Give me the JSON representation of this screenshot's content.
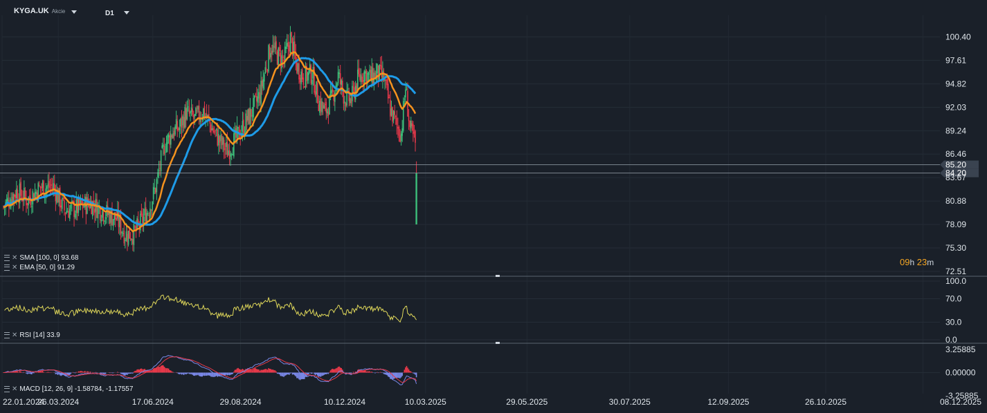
{
  "header": {
    "symbol": "KYGA.UK",
    "symbol_type": "Akcie",
    "timeframe": "D1"
  },
  "timer": {
    "hours": "09",
    "hours_unit": "h",
    "minutes": "23",
    "minutes_unit": "m"
  },
  "colors": {
    "background": "#1a2029",
    "up": "#3dbf7a",
    "down": "#e8394a",
    "sma": "#1e9be8",
    "ema": "#f5921e",
    "rsi": "#e0d85a",
    "macd_line": "#7a88e8",
    "macd_signal": "#e8394a"
  },
  "chart_data": [
    {
      "type": "candlestick",
      "name": "price",
      "y_ticks": [
        "100.40",
        "97.61",
        "94.82",
        "92.03",
        "89.24",
        "86.46",
        "83.67",
        "80.88",
        "78.09",
        "75.30",
        "72.51"
      ],
      "ylim": [
        72.51,
        101.5
      ],
      "x_ticks": [
        "22.01.2024",
        "26.03.2024",
        "17.06.2024",
        "29.08.2024",
        "10.12.2024",
        "10.03.2025",
        "29.05.2025",
        "30.07.2025",
        "12.09.2025",
        "26.10.2025",
        "08.12.2025"
      ],
      "price_lines": [
        {
          "label": "85.20",
          "value": 85.2
        },
        {
          "label": "84.20",
          "value": 84.2
        }
      ],
      "anchors": [
        [
          0,
          80.2
        ],
        [
          12,
          82.1
        ],
        [
          22,
          81.0
        ],
        [
          34,
          82.5
        ],
        [
          46,
          82.6
        ],
        [
          56,
          79.8
        ],
        [
          68,
          80.0
        ],
        [
          80,
          80.7
        ],
        [
          92,
          79.6
        ],
        [
          104,
          78.8
        ],
        [
          112,
          76.9
        ],
        [
          120,
          77.0
        ],
        [
          127,
          78.4
        ],
        [
          134,
          80.0
        ],
        [
          140,
          82.5
        ],
        [
          148,
          87.5
        ],
        [
          156,
          89.2
        ],
        [
          162,
          89.6
        ],
        [
          168,
          91.4
        ],
        [
          176,
          90.6
        ],
        [
          184,
          91.6
        ],
        [
          192,
          89.5
        ],
        [
          200,
          87.8
        ],
        [
          206,
          86.8
        ],
        [
          212,
          87.9
        ],
        [
          220,
          89.6
        ],
        [
          228,
          91.4
        ],
        [
          236,
          93.5
        ],
        [
          240,
          96.0
        ],
        [
          246,
          99.3
        ],
        [
          252,
          98.2
        ],
        [
          258,
          97.6
        ],
        [
          264,
          100.2
        ],
        [
          270,
          96.9
        ],
        [
          276,
          95.6
        ],
        [
          284,
          96.1
        ],
        [
          290,
          92.8
        ],
        [
          296,
          91.5
        ],
        [
          302,
          93.0
        ],
        [
          308,
          95.8
        ],
        [
          314,
          93.1
        ],
        [
          320,
          92.9
        ],
        [
          326,
          95.3
        ],
        [
          332,
          96.2
        ],
        [
          338,
          95.5
        ],
        [
          344,
          96.1
        ],
        [
          350,
          95.4
        ],
        [
          356,
          91.8
        ],
        [
          362,
          89.8
        ],
        [
          366,
          88.9
        ],
        [
          370,
          94.5
        ],
        [
          374,
          89.5
        ],
        [
          378,
          88.0
        ],
        [
          380,
          87.1
        ]
      ],
      "final_candle": {
        "open": 84.2,
        "high": 85.6,
        "low": 78.1,
        "close": 78.1
      },
      "sma": {
        "label": "SMA [100, 0] 93.68",
        "value": 93.68
      },
      "ema": {
        "label": "EMA [50, 0] 91.29",
        "value": 91.29
      }
    },
    {
      "type": "line",
      "name": "rsi",
      "y_ticks": [
        "100.0",
        "70.0",
        "30.0",
        "0.0"
      ],
      "ylim": [
        0,
        100
      ],
      "label": "RSI [14] 33.9",
      "value": 33.9
    },
    {
      "type": "bar",
      "name": "macd",
      "y_ticks": [
        "3.25885",
        "0.00000",
        "-3.25885"
      ],
      "ylim": [
        -3.25885,
        3.25885
      ],
      "label": "MACD [12, 26, 9] -1.58784, -1.17557",
      "values": [
        -1.58784,
        -1.17557
      ]
    }
  ]
}
